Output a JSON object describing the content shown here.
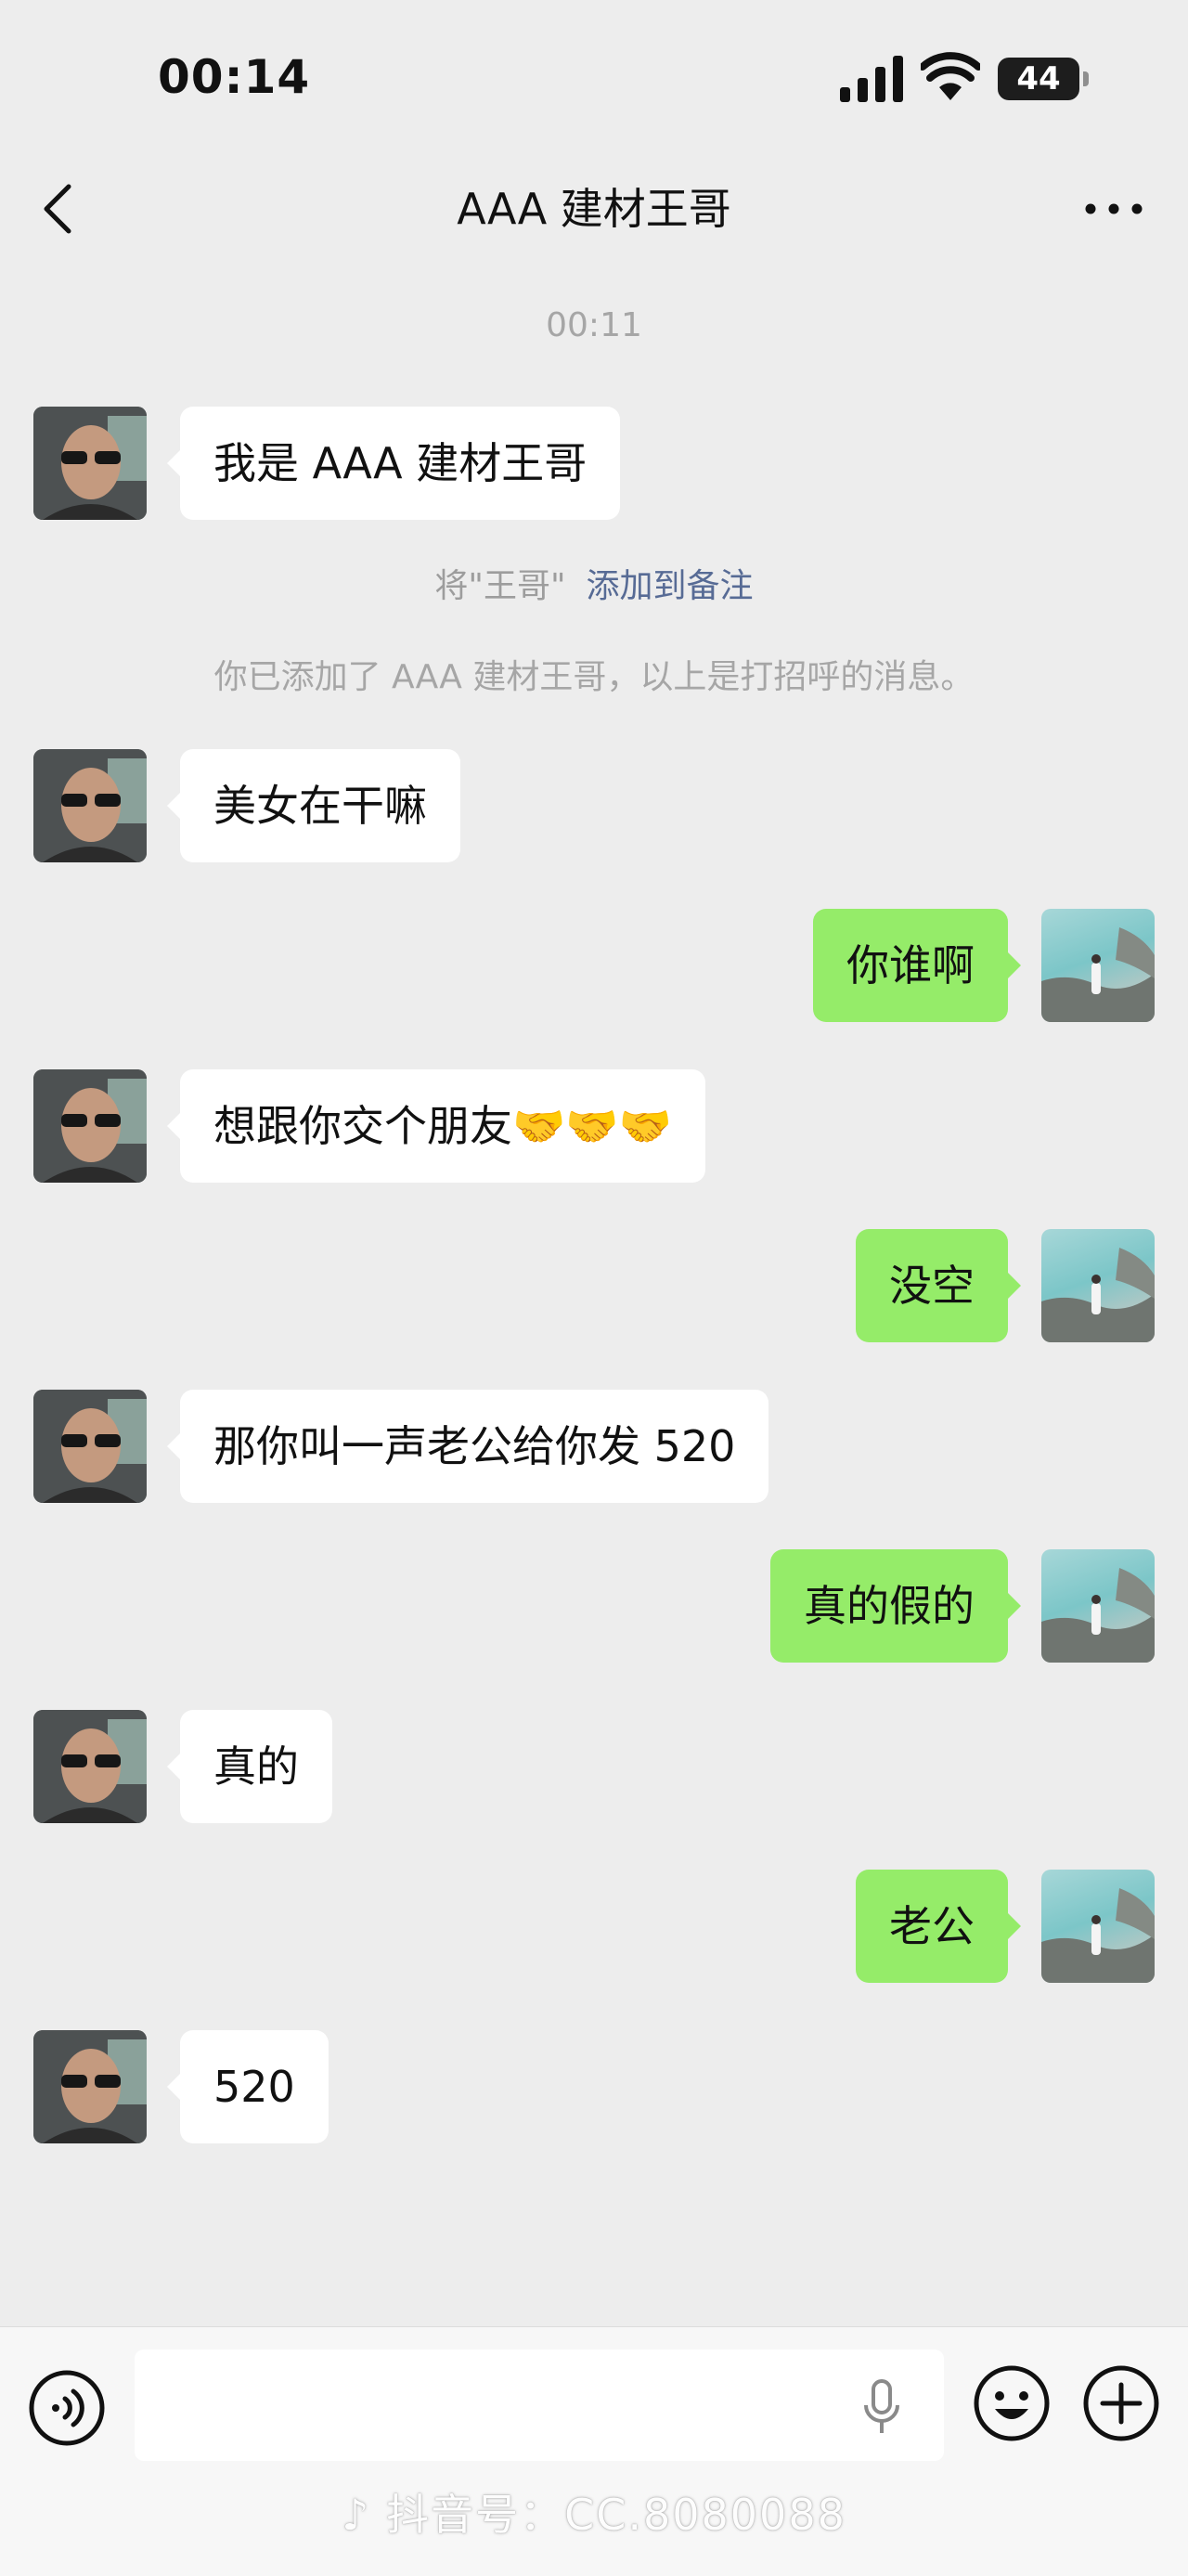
{
  "status_bar": {
    "time": "00:14",
    "battery": "44"
  },
  "header": {
    "title": "AAA 建材王哥"
  },
  "timestamp": "00:11",
  "system": {
    "remark_prefix": "将\"王哥\"",
    "remark_link": "添加到备注",
    "added_notice": "你已添加了 AAA 建材王哥，以上是打招呼的消息。"
  },
  "messages": [
    {
      "from": "王哥",
      "text": "我是 AAA 建材王哥"
    },
    {
      "from": "王哥",
      "text": "美女在干嘛"
    },
    {
      "from": "me",
      "text": "你谁啊"
    },
    {
      "from": "王哥",
      "text": "想跟你交个朋友🤝🤝🤝"
    },
    {
      "from": "me",
      "text": "没空"
    },
    {
      "from": "王哥",
      "text": "那你叫一声老公给你发 520"
    },
    {
      "from": "me",
      "text": "真的假的"
    },
    {
      "from": "王哥",
      "text": "真的"
    },
    {
      "from": "me",
      "text": "老公"
    },
    {
      "from": "王哥",
      "text": "520"
    }
  ],
  "input_bar": {
    "text": ""
  },
  "watermark": "抖音号：CC.8080088",
  "colors": {
    "background": "#ededed",
    "bubble_out": "#95ec69",
    "bubble_in": "#ffffff",
    "link": "#576b95"
  }
}
